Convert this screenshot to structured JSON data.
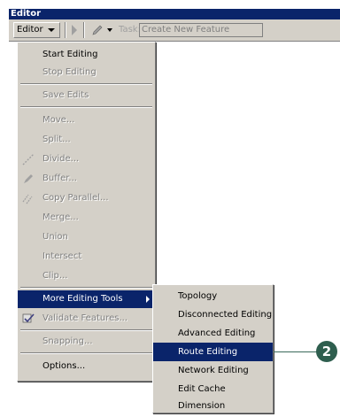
{
  "window": {
    "title": "Editor"
  },
  "toolbar": {
    "editor_menu_label": "Editor",
    "task_label": "Task:",
    "task_value": "Create New Feature"
  },
  "editor_menu": {
    "items": [
      {
        "label": "Start Editing",
        "enabled": true
      },
      {
        "label": "Stop Editing",
        "enabled": false
      },
      {
        "label": "Save Edits",
        "enabled": false
      },
      {
        "label": "Move...",
        "enabled": false
      },
      {
        "label": "Split...",
        "enabled": false
      },
      {
        "label": "Divide...",
        "enabled": false,
        "icon": "divide-icon"
      },
      {
        "label": "Buffer...",
        "enabled": false,
        "icon": "buffer-icon"
      },
      {
        "label": "Copy Parallel...",
        "enabled": false,
        "icon": "copy-parallel-icon"
      },
      {
        "label": "Merge...",
        "enabled": false
      },
      {
        "label": "Union",
        "enabled": false
      },
      {
        "label": "Intersect",
        "enabled": false
      },
      {
        "label": "Clip...",
        "enabled": false
      },
      {
        "label": "More Editing Tools",
        "enabled": true,
        "highlighted": true,
        "has_submenu": true
      },
      {
        "label": "Validate Features...",
        "enabled": false,
        "icon": "validate-icon"
      },
      {
        "label": "Snapping...",
        "enabled": false
      },
      {
        "label": "Options...",
        "enabled": true
      }
    ]
  },
  "submenu": {
    "items": [
      {
        "label": "Topology"
      },
      {
        "label": "Disconnected Editing"
      },
      {
        "label": "Advanced Editing"
      },
      {
        "label": "Route Editing",
        "highlighted": true
      },
      {
        "label": "Network Editing"
      },
      {
        "label": "Edit Cache"
      },
      {
        "label": "Dimension"
      }
    ]
  },
  "callout": {
    "number": "2"
  },
  "colors": {
    "highlight": "#0a246a",
    "menu_bg": "#d4d0c8",
    "callout": "#2e5e4e"
  }
}
